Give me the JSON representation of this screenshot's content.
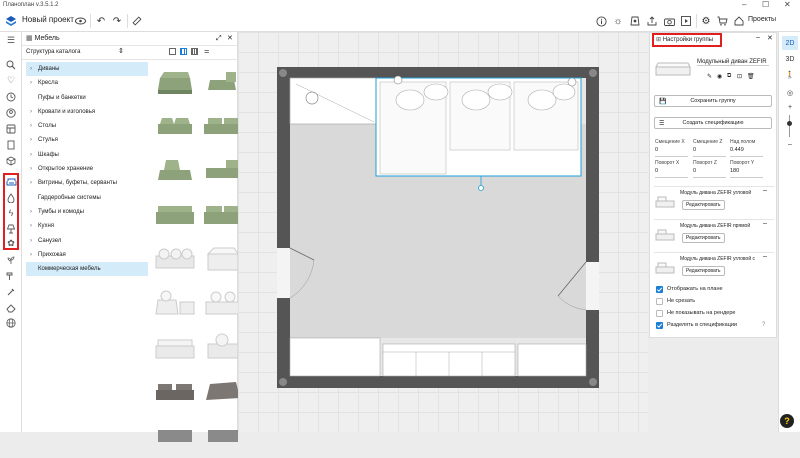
{
  "app": {
    "window_title": "Планоплан v.3.5.1.2"
  },
  "toolbar": {
    "project_title": "Новый проект",
    "projects_label": "Проекты"
  },
  "library": {
    "panel_title": "Мебель",
    "subheader": "Структура каталога",
    "categories": [
      {
        "label": "Диваны",
        "chevron": true,
        "selected": true
      },
      {
        "label": "Кресла",
        "chevron": true,
        "selected": false
      },
      {
        "label": "Пуфы и банкетки",
        "chevron": false,
        "selected": false
      },
      {
        "label": "Кровати и изголовья",
        "chevron": true,
        "selected": false
      },
      {
        "label": "Столы",
        "chevron": true,
        "selected": false
      },
      {
        "label": "Стулья",
        "chevron": true,
        "selected": false
      },
      {
        "label": "Шкафы",
        "chevron": true,
        "selected": false
      },
      {
        "label": "Открытое хранение",
        "chevron": true,
        "selected": false
      },
      {
        "label": "Витрины, буфеты, серванты",
        "chevron": true,
        "selected": false
      },
      {
        "label": "Гардеробные системы",
        "chevron": false,
        "selected": false
      },
      {
        "label": "Тумбы и комоды",
        "chevron": true,
        "selected": false
      },
      {
        "label": "Кухня",
        "chevron": true,
        "selected": false
      },
      {
        "label": "Санузел",
        "chevron": true,
        "selected": false
      },
      {
        "label": "Прихожая",
        "chevron": true,
        "selected": false
      },
      {
        "label": "Коммерческая мебель",
        "chevron": false,
        "selected": true
      }
    ]
  },
  "group_settings": {
    "title": "Настройки группы",
    "group_name": "Модульный диван ZEFIR",
    "save_group": "Сохранить группу",
    "create_spec": "Создать спецификацию",
    "offset_x_label": "Смещение X",
    "offset_x_value": "0",
    "offset_z_label": "Смещение Z",
    "offset_z_value": "0",
    "above_floor_label": "Над полом",
    "above_floor_value": "0.449",
    "rot_x_label": "Поворот X",
    "rot_x_value": "0",
    "rot_z_label": "Поворот Z",
    "rot_z_value": "0",
    "rot_y_label": "Поворот Y",
    "rot_y_value": "180",
    "modules": [
      {
        "name": "Модуль дивана ZEFIR угловой",
        "edit": "Редактировать"
      },
      {
        "name": "Модуль дивана ZEFIR прямой",
        "edit": "Редактировать"
      },
      {
        "name": "Модуль дивана ZEFIR угловой с",
        "edit": "Редактировать"
      }
    ],
    "checkboxes": [
      {
        "label": "Отображать на плане",
        "checked": true
      },
      {
        "label": "Не срезать",
        "checked": false
      },
      {
        "label": "Не показывать на рендере",
        "checked": false
      },
      {
        "label": "Разделять в спецификации",
        "checked": true
      }
    ]
  },
  "view_modes": {
    "two_d": "2D",
    "three_d": "3D"
  },
  "colors": {
    "accent": "#1a7fd8",
    "highlight": "#e02020",
    "wall": "#555555",
    "selection": "#1ea0d8"
  }
}
